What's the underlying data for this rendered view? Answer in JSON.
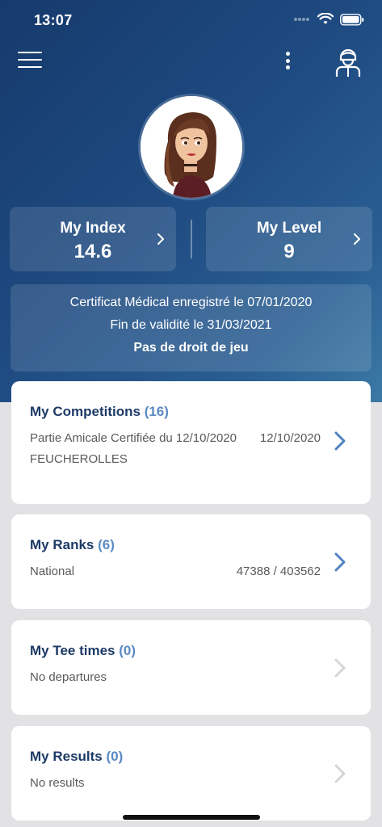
{
  "status": {
    "time": "13:07"
  },
  "stats": {
    "index": {
      "label": "My Index",
      "value": "14.6"
    },
    "level": {
      "label": "My Level",
      "value": "9"
    }
  },
  "certificate": {
    "line1": "Certificat Médical enregistré le 07/01/2020",
    "line2": "Fin de validité le 31/03/2021",
    "line3": "Pas de droit de jeu"
  },
  "competitions": {
    "title": "My Competitions",
    "count": "(16)",
    "name": "Partie Amicale Certifiée du 12/10/2020",
    "place": "FEUCHEROLLES",
    "date": "12/10/2020"
  },
  "ranks": {
    "title": "My Ranks",
    "count": "(6)",
    "scope": "National",
    "value": "47388 / 403562"
  },
  "tee_times": {
    "title": "My Tee times",
    "count": "(0)",
    "empty": "No departures"
  },
  "results": {
    "title": "My Results",
    "count": "(0)",
    "empty": "No results"
  },
  "colors": {
    "header": "#1e4a80",
    "title": "#1c3a66",
    "accent": "#5b8ac4",
    "chevron_active": "#4f82c3",
    "chevron_disabled": "#d6d6d6"
  }
}
